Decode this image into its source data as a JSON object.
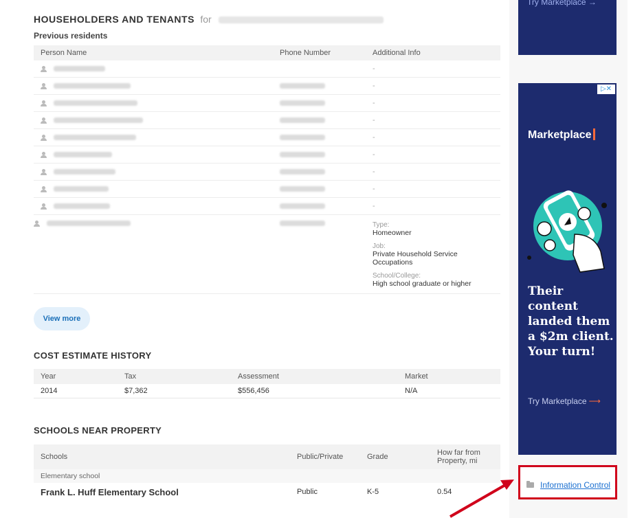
{
  "householders": {
    "title": "HOUSEHOLDERS AND TENANTS",
    "for_text": "for",
    "subtitle": "Previous residents",
    "columns": [
      "Person Name",
      "Phone Number",
      "Additional Info"
    ],
    "rows": [
      {
        "info": "-"
      },
      {
        "info": "-"
      },
      {
        "info": "-"
      },
      {
        "info": "-"
      },
      {
        "info": "-"
      },
      {
        "info": "-"
      },
      {
        "info": "-"
      },
      {
        "info": "-"
      },
      {
        "info": "-"
      }
    ],
    "last_row": {
      "type_label": "Type:",
      "type_value": "Homeowner",
      "job_label": "Job:",
      "job_value": "Private Household Service Occupations",
      "school_label": "School/College:",
      "school_value": "High school graduate or higher"
    },
    "view_more": "View more"
  },
  "cost": {
    "title": "COST ESTIMATE HISTORY",
    "columns": [
      "Year",
      "Tax",
      "Assessment",
      "Market"
    ],
    "rows": [
      [
        "2014",
        "$7,362",
        "$556,456",
        "N/A"
      ]
    ]
  },
  "schools": {
    "title": "SCHOOLS NEAR PROPERTY",
    "columns": [
      "Schools",
      "Public/Private",
      "Grade",
      "How far from Property, mi"
    ],
    "group": "Elementary school",
    "rows": [
      [
        "Frank L. Huff Elementary School",
        "Public",
        "K-5",
        "0.54"
      ]
    ]
  },
  "sidebar": {
    "ad_top_cta": "Try Marketplace →",
    "ad_brand": "Marketplace",
    "ad_headline": "Their content landed them a $2m client. Your turn!",
    "ad_cta": "Try Marketplace",
    "ad_cta_arrow": "⟶",
    "ad_choice": "▷✕",
    "info_control": "Information Control"
  },
  "colors": {
    "ad_bg": "#1d2b6e",
    "highlight": "#d0021b",
    "link": "#1a6fd0"
  }
}
